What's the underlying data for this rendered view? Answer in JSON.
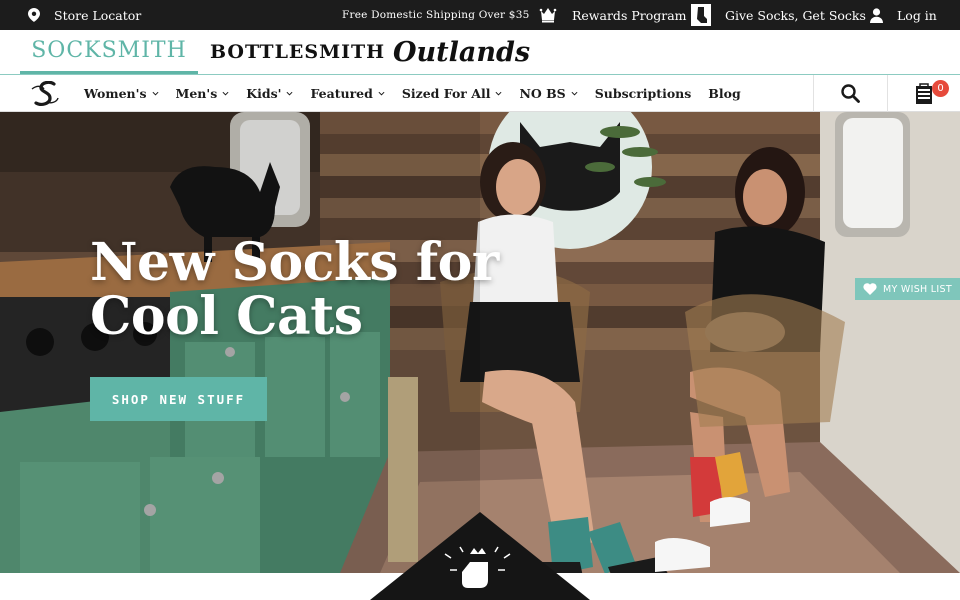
{
  "topbar": {
    "store_locator": "Store Locator",
    "shipping": "Free Domestic Shipping Over $35",
    "rewards": "Rewards Program",
    "give_socks": "Give Socks, Get Socks",
    "login": "Log in"
  },
  "brands": {
    "socksmith": "SOCKSMITH",
    "bottlesmith": "BOTTLESMITH",
    "outlands": "Outlands"
  },
  "nav": {
    "items": [
      {
        "label": "Women's",
        "has_dropdown": true
      },
      {
        "label": "Men's",
        "has_dropdown": true
      },
      {
        "label": "Kids'",
        "has_dropdown": true
      },
      {
        "label": "Featured",
        "has_dropdown": true
      },
      {
        "label": "Sized For All",
        "has_dropdown": true
      },
      {
        "label": "NO BS",
        "has_dropdown": true
      },
      {
        "label": "Subscriptions",
        "has_dropdown": false
      },
      {
        "label": "Blog",
        "has_dropdown": false
      }
    ],
    "cart_count": "0"
  },
  "hero": {
    "title_line1": "New Socks for",
    "title_line2": "Cool Cats",
    "cta": "SHOP NEW STUFF",
    "wishlist": "MY WISH LIST"
  },
  "colors": {
    "accent": "#5fb5a7",
    "topbar": "#1c1c1c",
    "badge": "#e64a3b"
  }
}
